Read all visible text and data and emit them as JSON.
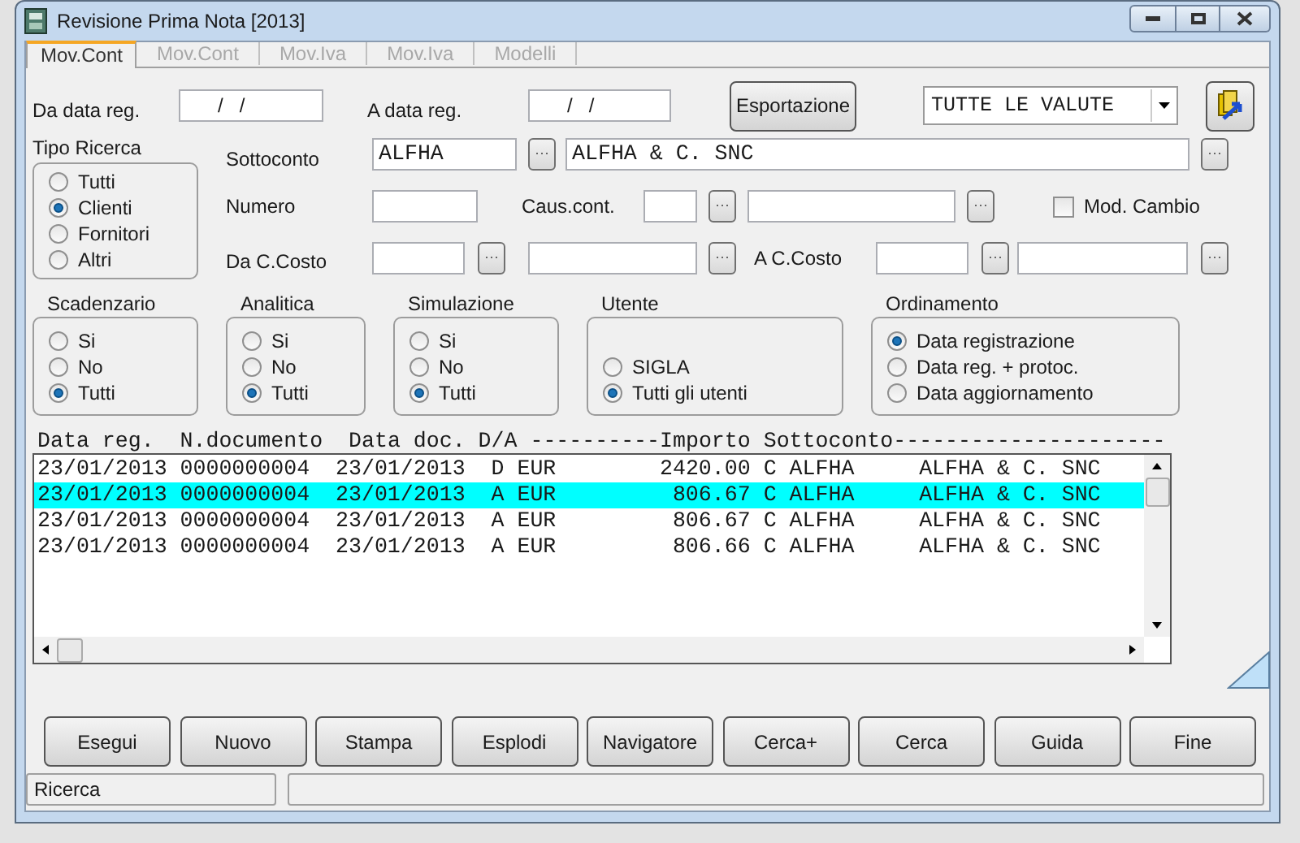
{
  "window": {
    "title": "Revisione Prima Nota [2013]"
  },
  "tabs": [
    {
      "label": "Mov.Cont",
      "selected": true
    },
    {
      "label": "Mov.Cont",
      "selected": false
    },
    {
      "label": "Mov.Iva",
      "selected": false
    },
    {
      "label": "Mov.Iva",
      "selected": false
    },
    {
      "label": "Modelli",
      "selected": false
    }
  ],
  "date_from": {
    "label": "Da data reg.",
    "value": "/   /"
  },
  "date_to": {
    "label": "A data reg.",
    "value": "/   /"
  },
  "export_button": "Esportazione",
  "currency": {
    "value": "TUTTE LE VALUTE"
  },
  "search_type": {
    "title": "Tipo Ricerca",
    "options": [
      {
        "label": "Tutti",
        "selected": false
      },
      {
        "label": "Clienti",
        "selected": true
      },
      {
        "label": "Fornitori",
        "selected": false
      },
      {
        "label": "Altri",
        "selected": false
      }
    ]
  },
  "sottoconto": {
    "label": "Sottoconto",
    "code": "ALFHA",
    "name": "ALFHA & C. SNC"
  },
  "numero": {
    "label": "Numero"
  },
  "caus_cont": {
    "label": "Caus.cont."
  },
  "mod_cambio": {
    "label": "Mod. Cambio",
    "checked": false
  },
  "da_c_costo": {
    "label": "Da C.Costo"
  },
  "a_c_costo": {
    "label": "A C.Costo"
  },
  "groups": [
    {
      "title": "Scadenzario",
      "options": [
        {
          "label": "Si",
          "selected": false
        },
        {
          "label": "No",
          "selected": false
        },
        {
          "label": "Tutti",
          "selected": true
        }
      ]
    },
    {
      "title": "Analitica",
      "options": [
        {
          "label": "Si",
          "selected": false
        },
        {
          "label": "No",
          "selected": false
        },
        {
          "label": "Tutti",
          "selected": true
        }
      ]
    },
    {
      "title": "Simulazione",
      "options": [
        {
          "label": "Si",
          "selected": false
        },
        {
          "label": "No",
          "selected": false
        },
        {
          "label": "Tutti",
          "selected": true
        }
      ]
    },
    {
      "title": "Utente",
      "options": [
        {
          "label": "SIGLA",
          "selected": false
        },
        {
          "label": "Tutti gli utenti",
          "selected": true
        }
      ]
    },
    {
      "title": "Ordinamento",
      "options": [
        {
          "label": "Data registrazione",
          "selected": true
        },
        {
          "label": "Data reg. + protoc.",
          "selected": false
        },
        {
          "label": "Data aggiornamento",
          "selected": false
        }
      ]
    }
  ],
  "grid": {
    "header": "Data reg.  N.documento  Data doc. D/A ----------Importo Sottoconto---------------------",
    "rows": [
      {
        "data_reg": "23/01/2013",
        "n_documento": "0000000004",
        "data_doc": "23/01/2013",
        "d_a": "D",
        "valuta": "EUR",
        "importo": "2420.00",
        "sottoconto": "C ALFHA",
        "nome": "ALFHA & C. SNC",
        "selected": false
      },
      {
        "data_reg": "23/01/2013",
        "n_documento": "0000000004",
        "data_doc": "23/01/2013",
        "d_a": "A",
        "valuta": "EUR",
        "importo": "806.67",
        "sottoconto": "C ALFHA",
        "nome": "ALFHA & C. SNC",
        "selected": true
      },
      {
        "data_reg": "23/01/2013",
        "n_documento": "0000000004",
        "data_doc": "23/01/2013",
        "d_a": "A",
        "valuta": "EUR",
        "importo": "806.67",
        "sottoconto": "C ALFHA",
        "nome": "ALFHA & C. SNC",
        "selected": false
      },
      {
        "data_reg": "23/01/2013",
        "n_documento": "0000000004",
        "data_doc": "23/01/2013",
        "d_a": "A",
        "valuta": "EUR",
        "importo": "806.66",
        "sottoconto": "C ALFHA",
        "nome": "ALFHA & C. SNC",
        "selected": false
      }
    ]
  },
  "buttons": [
    "Esegui",
    "Nuovo",
    "Stampa",
    "Esplodi",
    "Navigatore",
    "Cerca+",
    "Cerca",
    "Guida",
    "Fine"
  ],
  "status_bar": {
    "text": "Ricerca"
  }
}
